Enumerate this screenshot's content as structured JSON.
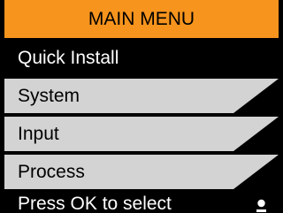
{
  "header": {
    "title": "MAIN MENU"
  },
  "menu": {
    "items": [
      {
        "label": "Quick Install",
        "selected": true
      },
      {
        "label": "System",
        "selected": false
      },
      {
        "label": "Input",
        "selected": false
      },
      {
        "label": "Process",
        "selected": false
      }
    ]
  },
  "footer": {
    "hint": "Press OK to select",
    "indicator_icon": "page-indicator-icon"
  },
  "colors": {
    "title_background": "#f7941d",
    "item_background": "#d3d3d3",
    "selected_background": "#000000",
    "frame": "#000000"
  }
}
